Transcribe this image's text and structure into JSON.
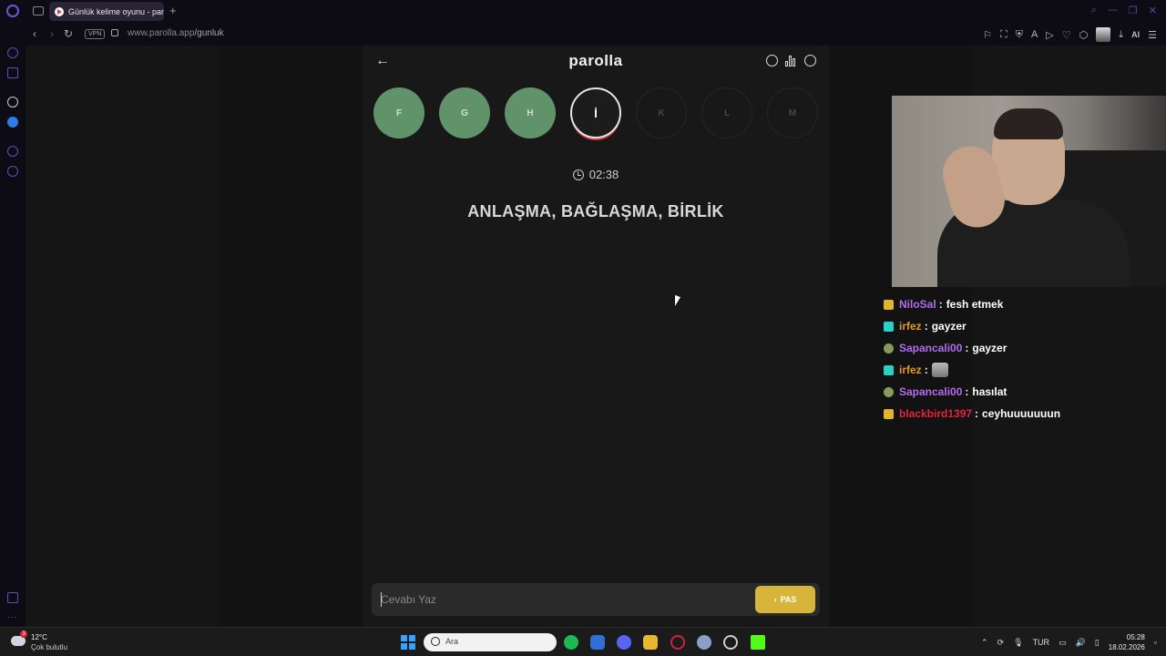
{
  "browser": {
    "tab_title": "Günlük kelime oyunu - par",
    "new_tab": "+",
    "vpn": "VPN",
    "url_host": "www.parolla.app",
    "url_path": "/gunluk",
    "ai_label": "AI"
  },
  "game": {
    "logo": "parolla",
    "back": "←",
    "letters": [
      {
        "label": "F",
        "state": "done"
      },
      {
        "label": "G",
        "state": "done"
      },
      {
        "label": "H",
        "state": "done"
      },
      {
        "label": "İ",
        "state": "current"
      },
      {
        "label": "K",
        "state": "pending"
      },
      {
        "label": "L",
        "state": "pending"
      },
      {
        "label": "M",
        "state": "pending"
      }
    ],
    "timer": "02:38",
    "clue": "ANLAŞMA, BAĞLAŞMA, BİRLİK",
    "answer_placeholder": "Cevabı Yaz",
    "pass_label": "PAS",
    "pass_chevron": "›"
  },
  "chat": [
    {
      "user": "NiloSal",
      "color": "#b36cf0",
      "badge": "crown",
      "msg": "fesh etmek"
    },
    {
      "user": "irfez",
      "color": "#e8952a",
      "badge": "grid",
      "msg": "gayzer"
    },
    {
      "user": "Sapancali00",
      "color": "#b36cf0",
      "badge": "turtle",
      "msg": "gayzer"
    },
    {
      "user": "irfez",
      "color": "#e8952a",
      "badge": "grid",
      "msg": "",
      "emote": true
    },
    {
      "user": "Sapancali00",
      "color": "#b36cf0",
      "badge": "turtle",
      "msg": "hasılat"
    },
    {
      "user": "blackbird1397",
      "color": "#e0243c",
      "badge": "crown",
      "msg": "ceyhuuuuuuun"
    }
  ],
  "taskbar": {
    "weather_badge": "3",
    "temp": "12°C",
    "weather_desc": "Çok bulutlu",
    "search": "Ara",
    "lang": "TUR",
    "time": "05:28",
    "date": "18.02.2026"
  },
  "colors": {
    "done": "#6aa174",
    "pass": "#d6b53a",
    "accent": "#6e55d9"
  }
}
